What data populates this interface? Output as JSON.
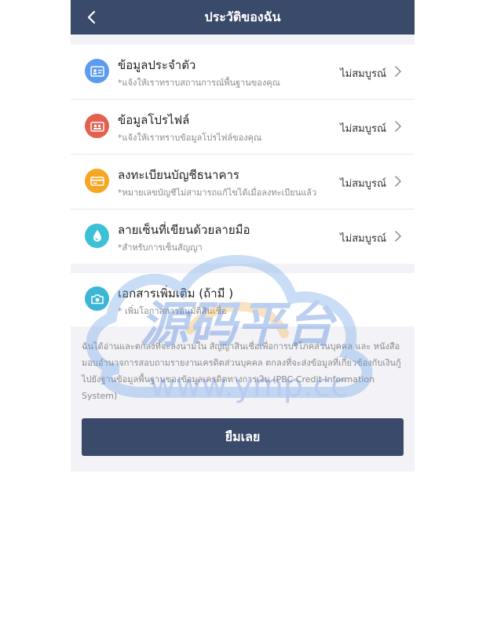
{
  "header": {
    "title": "ประวัติของฉัน"
  },
  "items": [
    {
      "title": "ข้อมูลประจำตัว",
      "subtitle": "*แจ้งให้เราทราบสถานการณ์พื้นฐานของคุณ",
      "status": "ไม่สมบูรณ์",
      "icon": "id-card-icon",
      "color": "#5b9cf0"
    },
    {
      "title": "ข้อมูลโปรไฟล์",
      "subtitle": "*แจ้งให้เราทราบข้อมูลโปรไฟล์ของคุณ",
      "status": "ไม่สมบูรณ์",
      "icon": "profile-card-icon",
      "color": "#e4604f"
    },
    {
      "title": "ลงทะเบียนบัญชีธนาคาร",
      "subtitle": "*หมายเลขบัญชีไม่สามารถแก้ไขได้เมื่อลงทะเบียนแล้ว",
      "status": "ไม่สมบูรณ์",
      "icon": "bank-card-icon",
      "color": "#f5a623"
    },
    {
      "title": "ลายเซ็นที่เขียนด้วยลายมือ",
      "subtitle": "*สำหรับการเซ็นสัญญา",
      "status": "ไม่สมบูรณ์",
      "icon": "signature-drop-icon",
      "color": "#3cc0d6"
    }
  ],
  "optional": {
    "title": "เอกสารเพิ่มเติม (ถ้ามี )",
    "subtitle": "* เพิ่มโอกาสการอนุมัติสินเชื่อ",
    "icon": "camera-icon",
    "color": "#3cb6d6"
  },
  "consent": {
    "text": "ฉันได้อ่านและตกลงที่จะลงนามใน สัญญาสินเชื่อเพื่อการบริโภคส่วนบุคคล และ หนังสือมอบอำนาจการสอบถามรายงานเครดิตส่วนบุคคล ตกลงที่จะส่งข้อมูลที่เกี่ยวข้องกับเงินกู้ไปยังฐานข้อมูลพื้นฐานของข้อมูลเครดิตทางการเงิน (PBC Credit Information System)"
  },
  "button": {
    "label": "ยืมเลย"
  },
  "watermark": {
    "text_cn": "源码平台",
    "text_url": "www.ymp.cc"
  },
  "colors": {
    "header": "#3a4a6b",
    "button": "#3a4a6b",
    "background": "#f3f3f7"
  }
}
